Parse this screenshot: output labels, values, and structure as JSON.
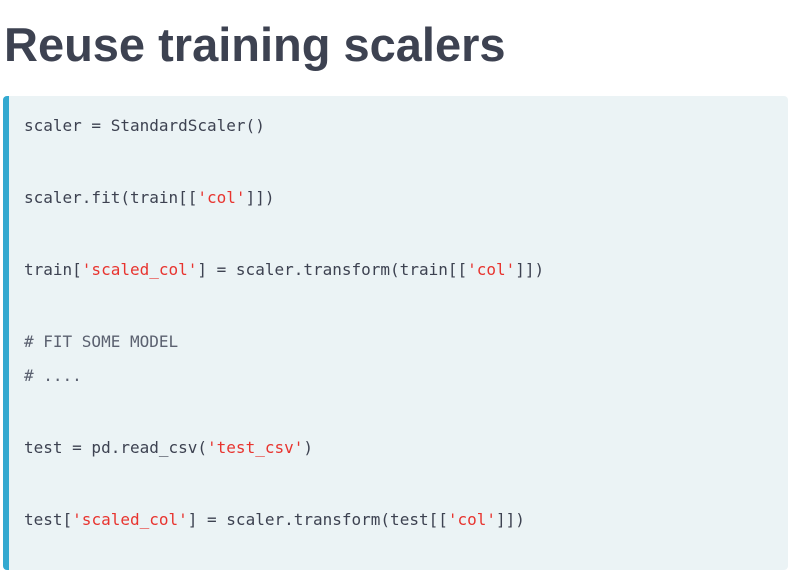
{
  "slide": {
    "title": "Reuse training scalers"
  },
  "code": {
    "language": "python",
    "colors": {
      "accent_bar": "#33a9d0",
      "background": "#ebf3f5",
      "text": "#3d4251",
      "string": "#e8342f"
    },
    "lines": [
      {
        "tokens": [
          {
            "type": "plain",
            "text": "scaler = StandardScaler()"
          }
        ]
      },
      {
        "tokens": []
      },
      {
        "tokens": [
          {
            "type": "plain",
            "text": "scaler.fit(train[["
          },
          {
            "type": "string",
            "text": "'col'"
          },
          {
            "type": "plain",
            "text": "]])"
          }
        ]
      },
      {
        "tokens": []
      },
      {
        "tokens": [
          {
            "type": "plain",
            "text": "train["
          },
          {
            "type": "string",
            "text": "'scaled_col'"
          },
          {
            "type": "plain",
            "text": "] = scaler.transform(train[["
          },
          {
            "type": "string",
            "text": "'col'"
          },
          {
            "type": "plain",
            "text": "]])"
          }
        ]
      },
      {
        "tokens": []
      },
      {
        "tokens": [
          {
            "type": "comment",
            "text": "# FIT SOME MODEL"
          }
        ]
      },
      {
        "tokens": [
          {
            "type": "comment",
            "text": "# ...."
          }
        ]
      },
      {
        "tokens": []
      },
      {
        "tokens": [
          {
            "type": "plain",
            "text": "test = pd.read_csv("
          },
          {
            "type": "string",
            "text": "'test_csv'"
          },
          {
            "type": "plain",
            "text": ")"
          }
        ]
      },
      {
        "tokens": []
      },
      {
        "tokens": [
          {
            "type": "plain",
            "text": "test["
          },
          {
            "type": "string",
            "text": "'scaled_col'"
          },
          {
            "type": "plain",
            "text": "] = scaler.transform(test[["
          },
          {
            "type": "string",
            "text": "'col'"
          },
          {
            "type": "plain",
            "text": "]])"
          }
        ]
      }
    ]
  }
}
